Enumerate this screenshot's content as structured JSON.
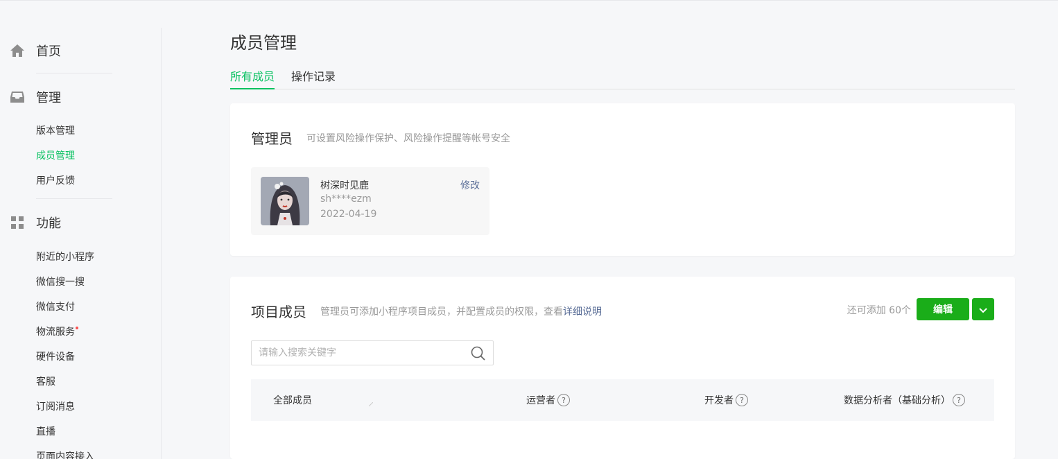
{
  "sidebar": {
    "home_label": "首页",
    "manage_label": "管理",
    "manage_items": [
      {
        "label": "版本管理"
      },
      {
        "label": "成员管理"
      },
      {
        "label": "用户反馈"
      }
    ],
    "features_label": "功能",
    "features_items": [
      {
        "label": "附近的小程序"
      },
      {
        "label": "微信搜一搜"
      },
      {
        "label": "微信支付"
      },
      {
        "label": "物流服务"
      },
      {
        "label": "硬件设备"
      },
      {
        "label": "客服"
      },
      {
        "label": "订阅消息"
      },
      {
        "label": "直播"
      },
      {
        "label": "页面内容接入"
      }
    ]
  },
  "page": {
    "title": "成员管理",
    "tabs": [
      {
        "label": "所有成员"
      },
      {
        "label": "操作记录"
      }
    ]
  },
  "admin": {
    "title": "管理员",
    "desc": "可设置风险操作保护、风险操作提醒等帐号安全",
    "name": "树深时见鹿",
    "account": "sh****ezm",
    "date": "2022-04-19",
    "edit_label": "修改"
  },
  "members": {
    "title": "项目成员",
    "desc_prefix": "管理员可添加小程序项目成员，并配置成员的权限，查看",
    "desc_link": "详细说明",
    "remaining": "还可添加 60个",
    "edit_button": "编辑",
    "search_placeholder": "请输入搜索关键字",
    "columns": [
      {
        "label": "全部成员"
      },
      {
        "label": "运营者"
      },
      {
        "label": "开发者"
      },
      {
        "label": "数据分析者（基础分析）"
      }
    ],
    "help_glyph": "?"
  },
  "colors": {
    "accent": "#07c160",
    "button": "#1aad19",
    "link": "#576b95"
  }
}
